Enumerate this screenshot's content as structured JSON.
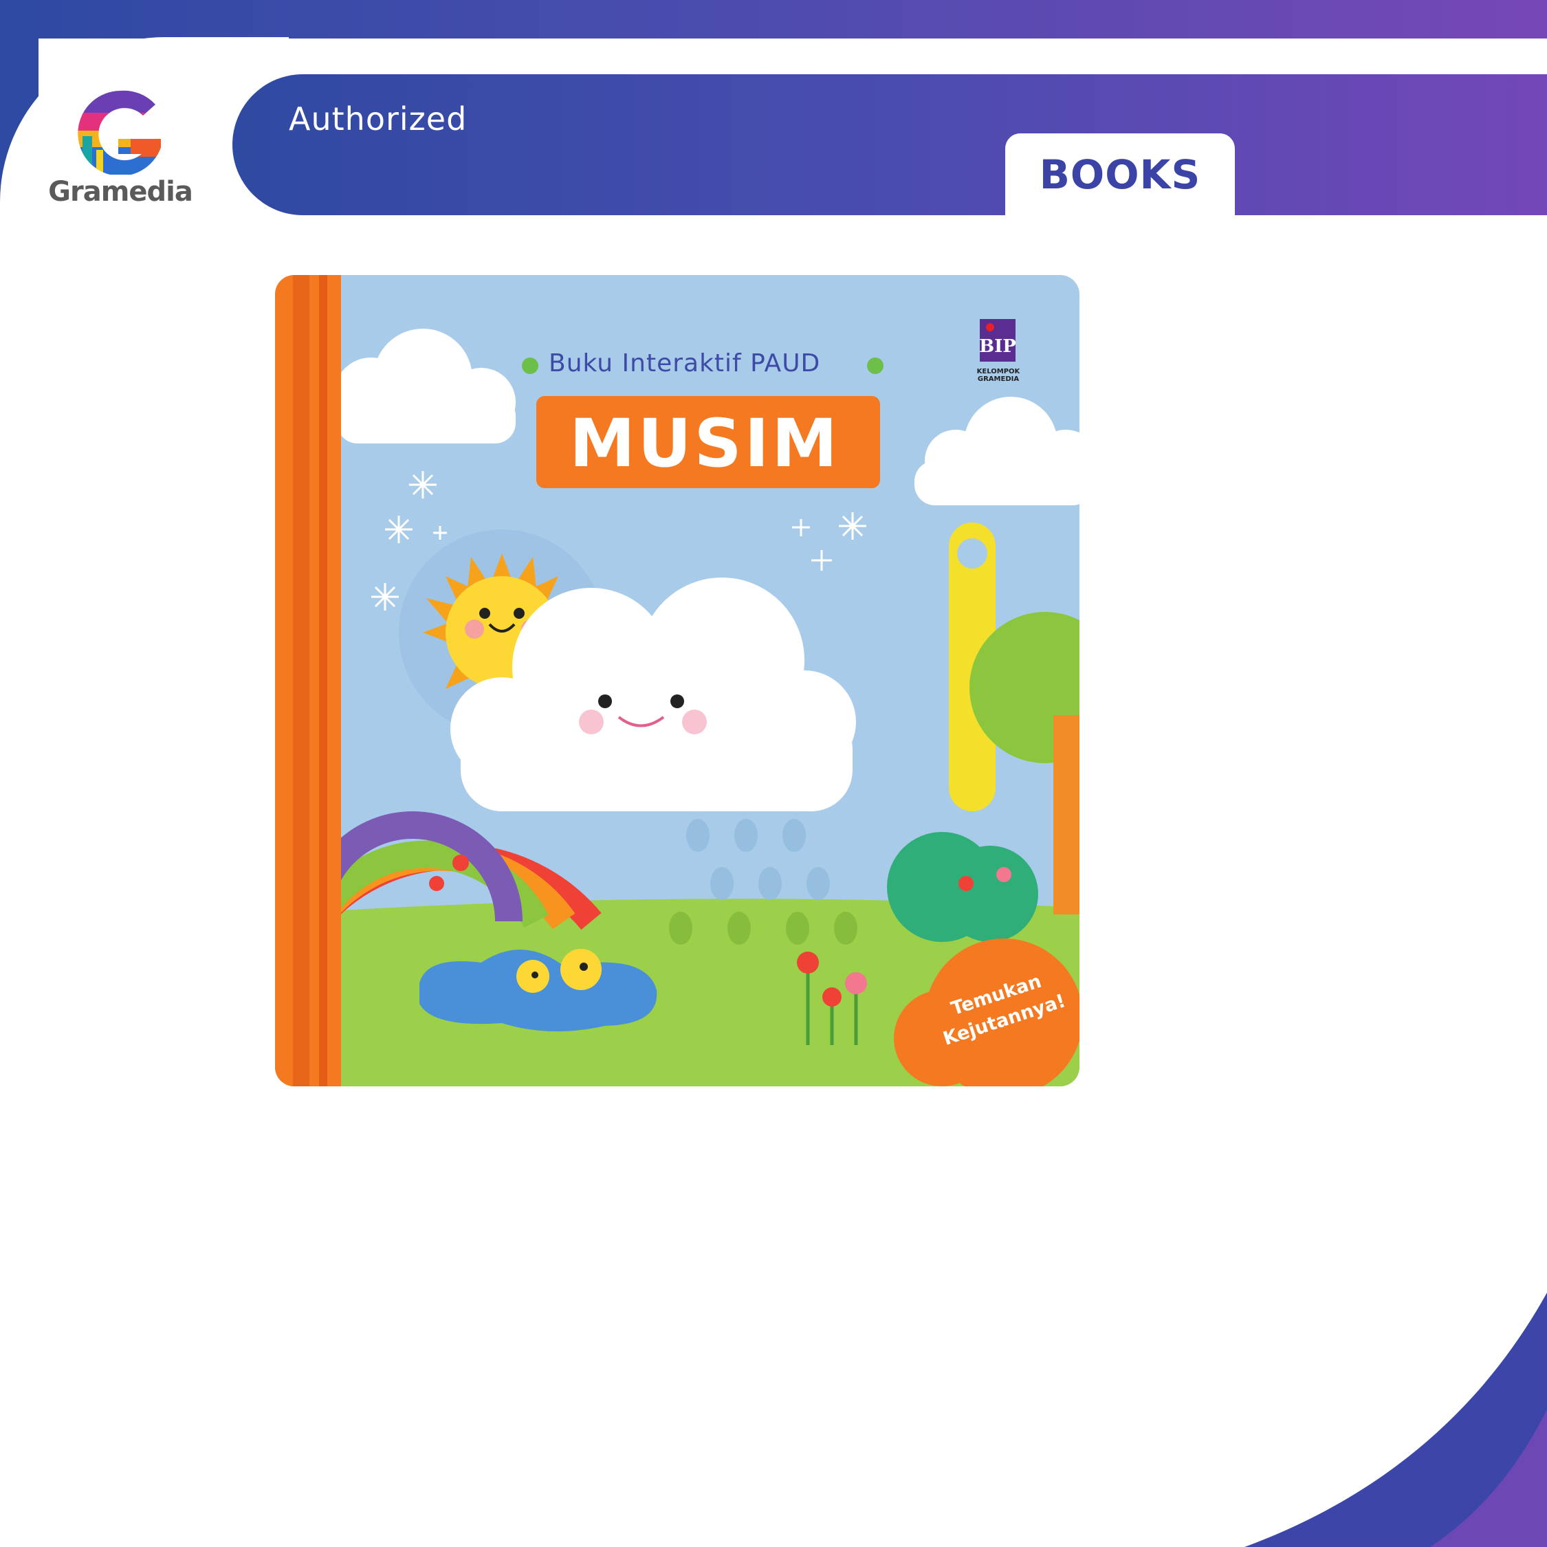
{
  "brand": {
    "logo_text": "Gramedia",
    "colors": {
      "primary_blue": "#2f4aa2",
      "purple": "#7347b8",
      "books_text": "#3b44a6"
    }
  },
  "banner": {
    "authorized_label": "Authorized",
    "category_tab_label": "BOOKS"
  },
  "product": {
    "series_label": "Buku Interaktif PAUD",
    "title": "MUSIM",
    "publisher_logo": "BIP",
    "publisher_caption_line1": "KELOMPOK",
    "publisher_caption_line2": "GRAMEDIA",
    "sticker_line1": "Temukan",
    "sticker_line2": "Kejutannya!"
  }
}
